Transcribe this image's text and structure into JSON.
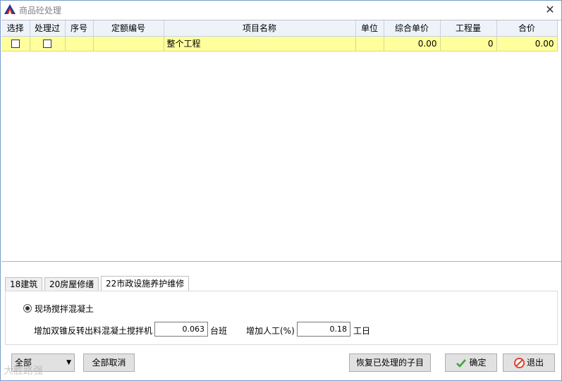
{
  "window": {
    "title": "商品砼处理",
    "close_glyph": "✕"
  },
  "grid": {
    "columns": [
      "选择",
      "处理过",
      "序号",
      "定额编号",
      "项目名称",
      "单位",
      "综合单价",
      "工程量",
      "合价"
    ],
    "rows": [
      {
        "select": false,
        "processed": false,
        "seq": "",
        "code": "",
        "name": "整个工程",
        "unit": "",
        "unit_price": "0.00",
        "quantity": "0",
        "total": "0.00"
      }
    ],
    "highlight_color": "#ffff9c"
  },
  "tabs": [
    {
      "label": "18建筑",
      "active": false
    },
    {
      "label": "20房屋修缮",
      "active": false
    },
    {
      "label": "22市政设施养护维修",
      "active": true
    }
  ],
  "panel": {
    "radio_label": "现场搅拌混凝土",
    "mixer_label": "增加双锥反转出料混凝土搅拌机",
    "mixer_value": "0.063",
    "mixer_unit": "台班",
    "labor_label": "增加人工(%)",
    "labor_value": "0.18",
    "labor_unit": "工日"
  },
  "footer": {
    "filter_select": "全部",
    "cancel_all": "全部取消",
    "restore": "恢复已处理的子目",
    "ok": "确定",
    "exit": "退出"
  },
  "watermark": "大胜路强",
  "colors": {
    "ok_icon": "#3aa63a",
    "exit_icon": "#e04030",
    "logo_red": "#d42020",
    "logo_blue": "#1a3a8a"
  }
}
